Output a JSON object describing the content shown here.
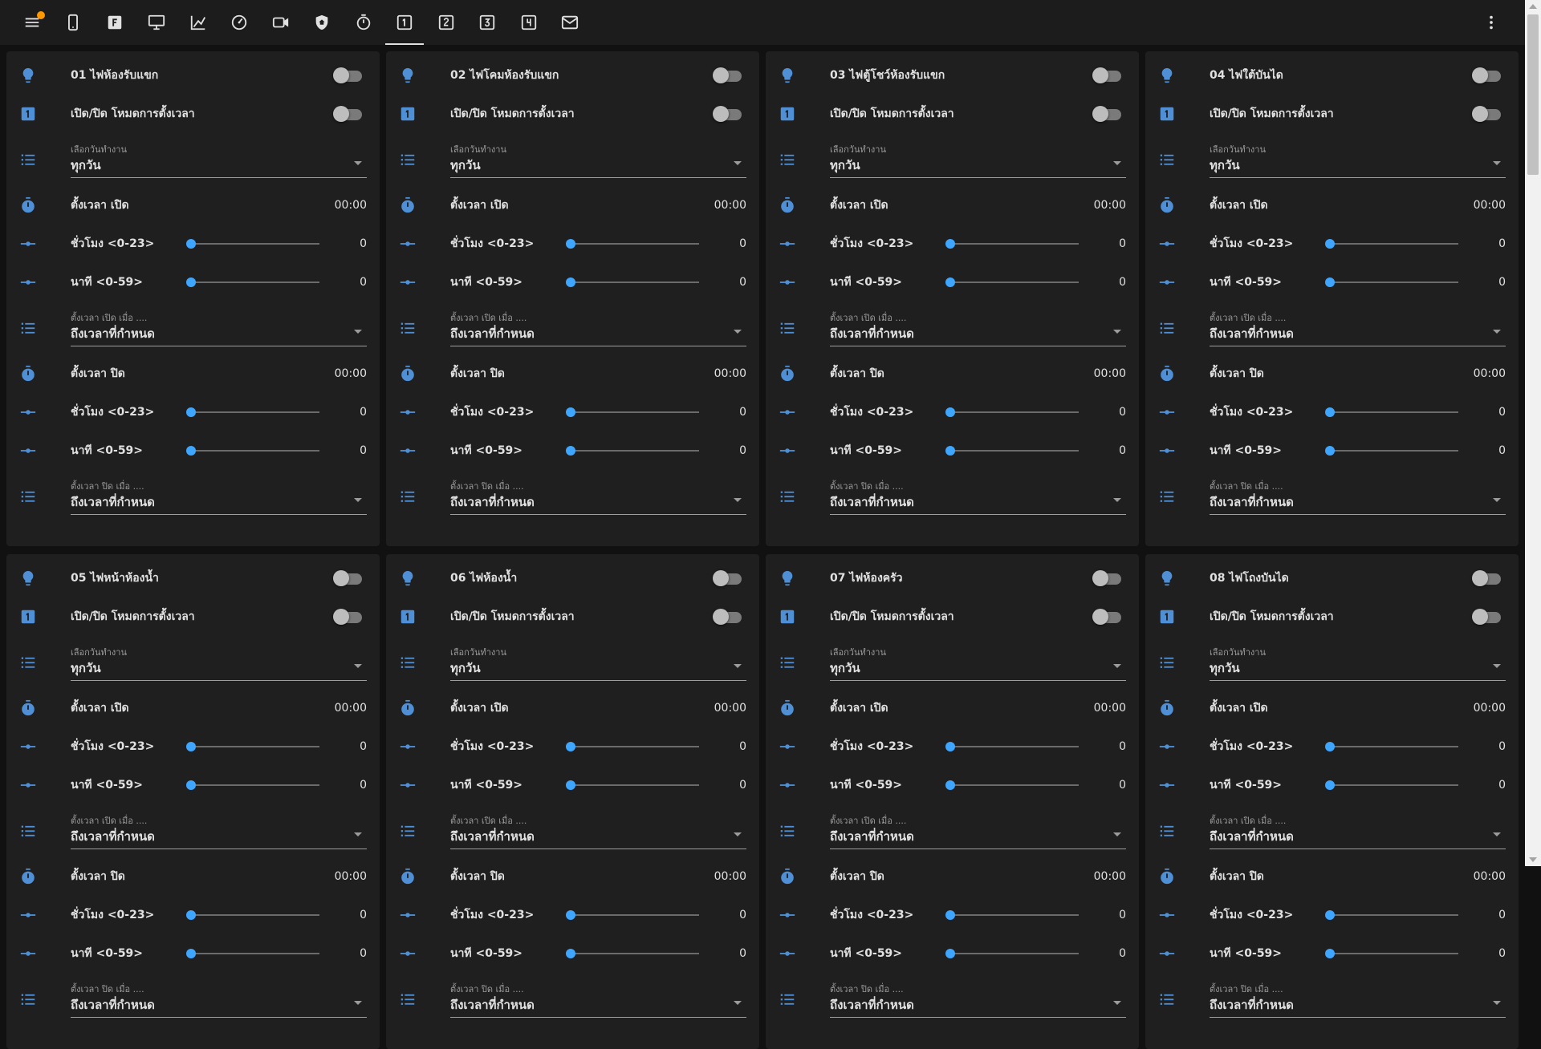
{
  "colors": {
    "accent": "#3ea6ff",
    "icon": "#4f8fd6",
    "badge": "#ff9800",
    "card": "#1f1f1f",
    "background": "#111111"
  },
  "toolbar": {
    "icons": [
      "menu-icon",
      "cellphone-icon",
      "floor-plan-icon",
      "monitor-icon",
      "chart-line-icon",
      "gauge-icon",
      "video-camera-icon",
      "security-shield-icon",
      "timer-icon",
      "numeric-1-box-icon",
      "numeric-2-box-icon",
      "numeric-3-box-icon",
      "numeric-4-box-icon",
      "email-icon"
    ],
    "active_tab": "numeric-1-box-icon",
    "badge_on": "menu-icon",
    "more": "dots-vertical-icon"
  },
  "labels": {
    "timer_mode": "เปิด/ปิด โหมดการตั้งเวลา",
    "day_caption": "เลือกวันทำงาน",
    "day_value": "ทุกวัน",
    "on_time": "ตั้งเวลา เปิด",
    "off_time": "ตั้งเวลา ปิด",
    "hour": "ชั่วโมง <0-23>",
    "minute": "นาที <0-59>",
    "on_when_caption": "ตั้งเวลา เปิด เมื่อ ....",
    "off_when_caption": "ตั้งเวลา ปิด เมื่อ ....",
    "when_value": "ถึงเวลาที่กำหนด"
  },
  "cards": [
    {
      "name": "01 ไฟห้องรับแขก",
      "light_on": false,
      "timer_mode_on": false,
      "on_time": "00:00",
      "on_hour": 0,
      "on_minute": 0,
      "off_time": "00:00",
      "off_hour": 0,
      "off_minute": 0
    },
    {
      "name": "02 ไฟโคมห้องรับแขก",
      "light_on": false,
      "timer_mode_on": false,
      "on_time": "00:00",
      "on_hour": 0,
      "on_minute": 0,
      "off_time": "00:00",
      "off_hour": 0,
      "off_minute": 0
    },
    {
      "name": "03 ไฟตู้โชว์ห้องรับแขก",
      "light_on": false,
      "timer_mode_on": false,
      "on_time": "00:00",
      "on_hour": 0,
      "on_minute": 0,
      "off_time": "00:00",
      "off_hour": 0,
      "off_minute": 0
    },
    {
      "name": "04 ไฟใต้บันได",
      "light_on": false,
      "timer_mode_on": false,
      "on_time": "00:00",
      "on_hour": 0,
      "on_minute": 0,
      "off_time": "00:00",
      "off_hour": 0,
      "off_minute": 0
    },
    {
      "name": "05 ไฟหน้าห้องน้ำ",
      "light_on": false,
      "timer_mode_on": false,
      "on_time": "00:00",
      "on_hour": 0,
      "on_minute": 0,
      "off_time": "00:00",
      "off_hour": 0,
      "off_minute": 0
    },
    {
      "name": "06 ไฟห้องน้ำ",
      "light_on": false,
      "timer_mode_on": false,
      "on_time": "00:00",
      "on_hour": 0,
      "on_minute": 0,
      "off_time": "00:00",
      "off_hour": 0,
      "off_minute": 0
    },
    {
      "name": "07 ไฟห้องครัว",
      "light_on": false,
      "timer_mode_on": false,
      "on_time": "00:00",
      "on_hour": 0,
      "on_minute": 0,
      "off_time": "00:00",
      "off_hour": 0,
      "off_minute": 0
    },
    {
      "name": "08 ไฟโถงบันได",
      "light_on": false,
      "timer_mode_on": false,
      "on_time": "00:00",
      "on_hour": 0,
      "on_minute": 0,
      "off_time": "00:00",
      "off_hour": 0,
      "off_minute": 0
    }
  ]
}
